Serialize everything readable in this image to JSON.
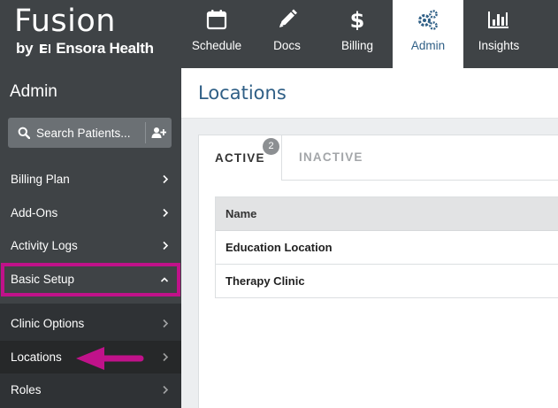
{
  "brand": {
    "name": "Fusion",
    "by": "by",
    "company": "Ensora Health"
  },
  "nav": [
    {
      "label": "Schedule",
      "icon": "calendar-icon"
    },
    {
      "label": "Docs",
      "icon": "pencil-icon"
    },
    {
      "label": "Billing",
      "icon": "dollar-icon"
    },
    {
      "label": "Admin",
      "icon": "gears-icon",
      "active": true
    },
    {
      "label": "Insights",
      "icon": "bar-chart-icon"
    }
  ],
  "sidebar": {
    "title": "Admin",
    "search_label": "Search Patients...",
    "items": [
      {
        "label": "Billing Plan"
      },
      {
        "label": "Add-Ons"
      },
      {
        "label": "Activity Logs"
      },
      {
        "label": "Basic Setup",
        "expanded": true
      }
    ],
    "sub_items": [
      {
        "label": "Clinic Options"
      },
      {
        "label": "Locations",
        "selected": true
      },
      {
        "label": "Roles"
      }
    ]
  },
  "main": {
    "title": "Locations",
    "tabs": [
      {
        "label": "ACTIVE",
        "badge": "2",
        "active": true
      },
      {
        "label": "INACTIVE"
      }
    ],
    "table": {
      "header": "Name",
      "rows": [
        "Education Location",
        "Therapy Clinic"
      ]
    }
  },
  "colors": {
    "header_bg": "#3f4346",
    "accent_blue": "#2f5f86",
    "highlight_magenta": "#c0128a"
  }
}
